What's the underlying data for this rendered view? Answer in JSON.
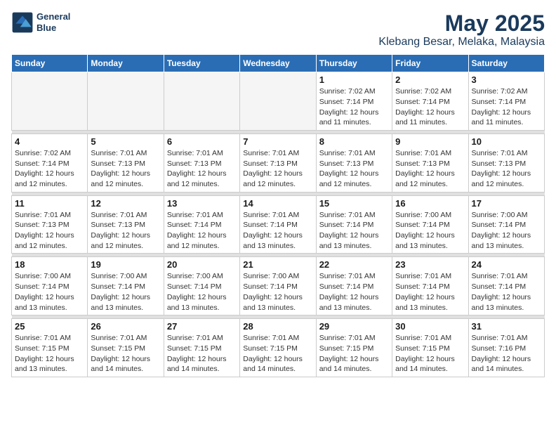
{
  "logo": {
    "line1": "General",
    "line2": "Blue"
  },
  "title": "May 2025",
  "location": "Klebang Besar, Melaka, Malaysia",
  "days_of_week": [
    "Sunday",
    "Monday",
    "Tuesday",
    "Wednesday",
    "Thursday",
    "Friday",
    "Saturday"
  ],
  "weeks": [
    [
      {
        "day": "",
        "info": ""
      },
      {
        "day": "",
        "info": ""
      },
      {
        "day": "",
        "info": ""
      },
      {
        "day": "",
        "info": ""
      },
      {
        "day": "1",
        "info": "Sunrise: 7:02 AM\nSunset: 7:14 PM\nDaylight: 12 hours\nand 11 minutes."
      },
      {
        "day": "2",
        "info": "Sunrise: 7:02 AM\nSunset: 7:14 PM\nDaylight: 12 hours\nand 11 minutes."
      },
      {
        "day": "3",
        "info": "Sunrise: 7:02 AM\nSunset: 7:14 PM\nDaylight: 12 hours\nand 11 minutes."
      }
    ],
    [
      {
        "day": "4",
        "info": "Sunrise: 7:02 AM\nSunset: 7:14 PM\nDaylight: 12 hours\nand 12 minutes."
      },
      {
        "day": "5",
        "info": "Sunrise: 7:01 AM\nSunset: 7:13 PM\nDaylight: 12 hours\nand 12 minutes."
      },
      {
        "day": "6",
        "info": "Sunrise: 7:01 AM\nSunset: 7:13 PM\nDaylight: 12 hours\nand 12 minutes."
      },
      {
        "day": "7",
        "info": "Sunrise: 7:01 AM\nSunset: 7:13 PM\nDaylight: 12 hours\nand 12 minutes."
      },
      {
        "day": "8",
        "info": "Sunrise: 7:01 AM\nSunset: 7:13 PM\nDaylight: 12 hours\nand 12 minutes."
      },
      {
        "day": "9",
        "info": "Sunrise: 7:01 AM\nSunset: 7:13 PM\nDaylight: 12 hours\nand 12 minutes."
      },
      {
        "day": "10",
        "info": "Sunrise: 7:01 AM\nSunset: 7:13 PM\nDaylight: 12 hours\nand 12 minutes."
      }
    ],
    [
      {
        "day": "11",
        "info": "Sunrise: 7:01 AM\nSunset: 7:13 PM\nDaylight: 12 hours\nand 12 minutes."
      },
      {
        "day": "12",
        "info": "Sunrise: 7:01 AM\nSunset: 7:13 PM\nDaylight: 12 hours\nand 12 minutes."
      },
      {
        "day": "13",
        "info": "Sunrise: 7:01 AM\nSunset: 7:14 PM\nDaylight: 12 hours\nand 12 minutes."
      },
      {
        "day": "14",
        "info": "Sunrise: 7:01 AM\nSunset: 7:14 PM\nDaylight: 12 hours\nand 13 minutes."
      },
      {
        "day": "15",
        "info": "Sunrise: 7:01 AM\nSunset: 7:14 PM\nDaylight: 12 hours\nand 13 minutes."
      },
      {
        "day": "16",
        "info": "Sunrise: 7:00 AM\nSunset: 7:14 PM\nDaylight: 12 hours\nand 13 minutes."
      },
      {
        "day": "17",
        "info": "Sunrise: 7:00 AM\nSunset: 7:14 PM\nDaylight: 12 hours\nand 13 minutes."
      }
    ],
    [
      {
        "day": "18",
        "info": "Sunrise: 7:00 AM\nSunset: 7:14 PM\nDaylight: 12 hours\nand 13 minutes."
      },
      {
        "day": "19",
        "info": "Sunrise: 7:00 AM\nSunset: 7:14 PM\nDaylight: 12 hours\nand 13 minutes."
      },
      {
        "day": "20",
        "info": "Sunrise: 7:00 AM\nSunset: 7:14 PM\nDaylight: 12 hours\nand 13 minutes."
      },
      {
        "day": "21",
        "info": "Sunrise: 7:00 AM\nSunset: 7:14 PM\nDaylight: 12 hours\nand 13 minutes."
      },
      {
        "day": "22",
        "info": "Sunrise: 7:01 AM\nSunset: 7:14 PM\nDaylight: 12 hours\nand 13 minutes."
      },
      {
        "day": "23",
        "info": "Sunrise: 7:01 AM\nSunset: 7:14 PM\nDaylight: 12 hours\nand 13 minutes."
      },
      {
        "day": "24",
        "info": "Sunrise: 7:01 AM\nSunset: 7:14 PM\nDaylight: 12 hours\nand 13 minutes."
      }
    ],
    [
      {
        "day": "25",
        "info": "Sunrise: 7:01 AM\nSunset: 7:15 PM\nDaylight: 12 hours\nand 13 minutes."
      },
      {
        "day": "26",
        "info": "Sunrise: 7:01 AM\nSunset: 7:15 PM\nDaylight: 12 hours\nand 14 minutes."
      },
      {
        "day": "27",
        "info": "Sunrise: 7:01 AM\nSunset: 7:15 PM\nDaylight: 12 hours\nand 14 minutes."
      },
      {
        "day": "28",
        "info": "Sunrise: 7:01 AM\nSunset: 7:15 PM\nDaylight: 12 hours\nand 14 minutes."
      },
      {
        "day": "29",
        "info": "Sunrise: 7:01 AM\nSunset: 7:15 PM\nDaylight: 12 hours\nand 14 minutes."
      },
      {
        "day": "30",
        "info": "Sunrise: 7:01 AM\nSunset: 7:15 PM\nDaylight: 12 hours\nand 14 minutes."
      },
      {
        "day": "31",
        "info": "Sunrise: 7:01 AM\nSunset: 7:16 PM\nDaylight: 12 hours\nand 14 minutes."
      }
    ]
  ]
}
